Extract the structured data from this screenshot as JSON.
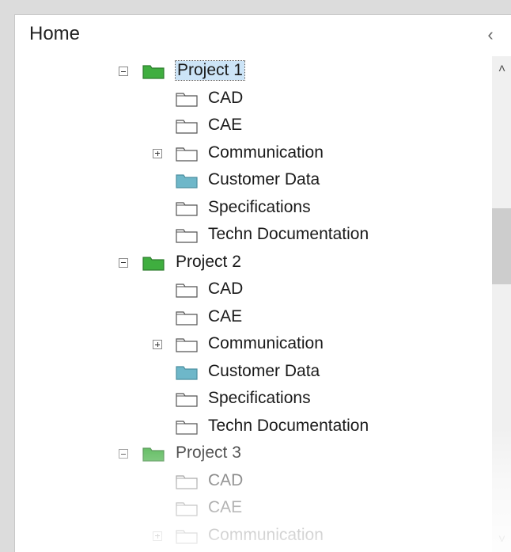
{
  "header": {
    "title": "Home",
    "collapse_glyph": "‹"
  },
  "scrollbar": {
    "up_glyph": "˄",
    "down_glyph": "˅"
  },
  "colors": {
    "project_folder": "#3fae3f",
    "customer_folder": "#6eb7c9",
    "plain_folder_outline": "#555555",
    "selection": "#cce4f7"
  },
  "tree": [
    {
      "label": "Project 1",
      "level": 0,
      "icon": "project-folder-icon",
      "expander": "minus",
      "selected": true
    },
    {
      "label": "CAD",
      "level": 1,
      "icon": "folder-icon",
      "expander": null
    },
    {
      "label": "CAE",
      "level": 1,
      "icon": "folder-icon",
      "expander": null
    },
    {
      "label": "Communication",
      "level": 1,
      "icon": "folder-icon",
      "expander": "plus"
    },
    {
      "label": "Customer Data",
      "level": 1,
      "icon": "customer-folder-icon",
      "expander": null
    },
    {
      "label": "Specifications",
      "level": 1,
      "icon": "folder-icon",
      "expander": null
    },
    {
      "label": "Techn Documentation",
      "level": 1,
      "icon": "folder-icon",
      "expander": null
    },
    {
      "label": "Project 2",
      "level": 0,
      "icon": "project-folder-icon",
      "expander": "minus"
    },
    {
      "label": "CAD",
      "level": 1,
      "icon": "folder-icon",
      "expander": null
    },
    {
      "label": "CAE",
      "level": 1,
      "icon": "folder-icon",
      "expander": null
    },
    {
      "label": "Communication",
      "level": 1,
      "icon": "folder-icon",
      "expander": "plus"
    },
    {
      "label": "Customer Data",
      "level": 1,
      "icon": "customer-folder-icon",
      "expander": null
    },
    {
      "label": "Specifications",
      "level": 1,
      "icon": "folder-icon",
      "expander": null
    },
    {
      "label": "Techn Documentation",
      "level": 1,
      "icon": "folder-icon",
      "expander": null
    },
    {
      "label": "Project 3",
      "level": 0,
      "icon": "project-folder-icon",
      "expander": "minus"
    },
    {
      "label": "CAD",
      "level": 1,
      "icon": "folder-icon",
      "expander": null
    },
    {
      "label": "CAE",
      "level": 1,
      "icon": "folder-icon",
      "expander": null
    },
    {
      "label": "Communication",
      "level": 1,
      "icon": "folder-icon",
      "expander": "plus"
    }
  ]
}
